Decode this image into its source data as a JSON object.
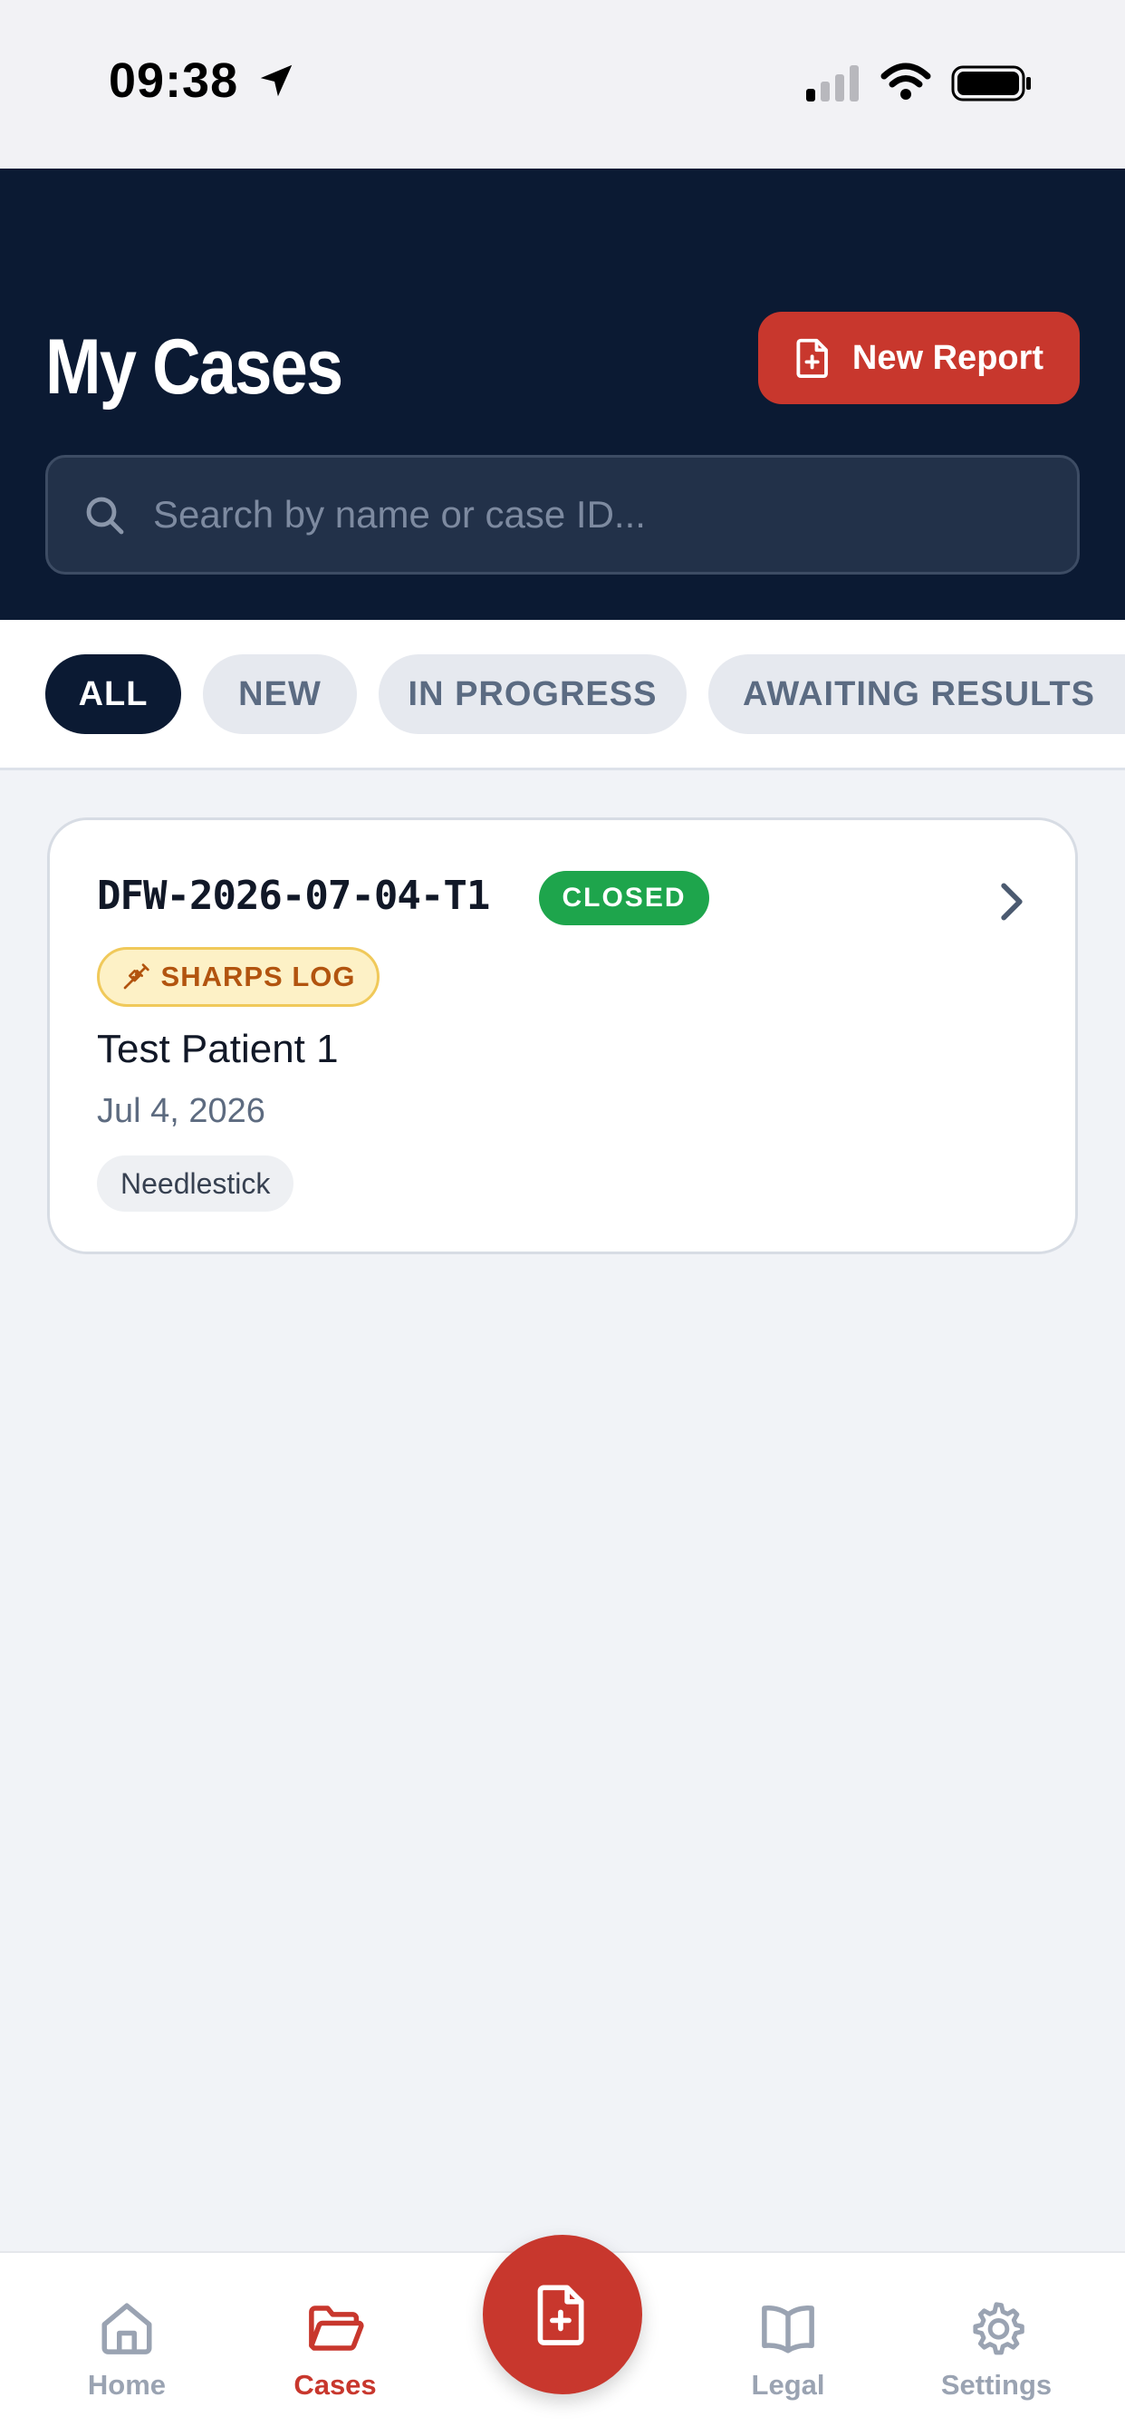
{
  "status_bar": {
    "time": "09:38"
  },
  "header": {
    "title": "My Cases",
    "new_report_label": "New Report",
    "search_placeholder": "Search by name or case ID..."
  },
  "filters": [
    {
      "label": "ALL",
      "active": true
    },
    {
      "label": "NEW",
      "active": false
    },
    {
      "label": "IN PROGRESS",
      "active": false
    },
    {
      "label": "AWAITING RESULTS",
      "active": false
    }
  ],
  "cases": [
    {
      "case_id": "DFW-2026-07-04-T1",
      "status": "CLOSED",
      "tag": "SHARPS LOG",
      "patient": "Test Patient 1",
      "date": "Jul 4, 2026",
      "category": "Needlestick"
    }
  ],
  "nav": {
    "items": [
      {
        "label": "Home",
        "icon": "home-icon",
        "active": false
      },
      {
        "label": "Cases",
        "icon": "folder-icon",
        "active": true
      },
      {
        "label": "Legal",
        "icon": "book-icon",
        "active": false
      },
      {
        "label": "Settings",
        "icon": "gear-icon",
        "active": false
      }
    ],
    "fab_icon": "new-document-icon"
  },
  "colors": {
    "header_bg": "#0b1a33",
    "accent_red": "#c8372d",
    "status_closed": "#1ea54c",
    "tag_bg": "#fdf1c6",
    "tag_text": "#b2540f"
  }
}
